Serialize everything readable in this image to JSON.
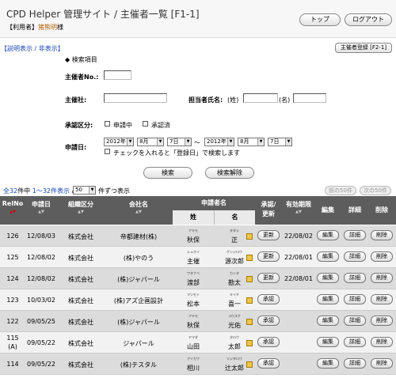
{
  "header": {
    "title": "CPD Helper 管理サイト / 主催者一覧 [F1-1]",
    "user_prefix": "【利用者】",
    "user_name": "猪熊明",
    "user_suffix": "様",
    "top_button": "トップ",
    "logout_button": "ログアウト"
  },
  "toolbar": {
    "toggle_link": "【説明表示 / 非表示】",
    "register_button": "主催者登録 [F2-1]"
  },
  "search": {
    "section_title": "◆ 検索項目",
    "organizer_no_label": "主催者No.:",
    "organizer_no_value": "",
    "organizer_label": "主催社:",
    "organizer_value": "",
    "person_label": "担当者氏名:",
    "last_name_tag": "(姓)",
    "first_name_tag": "(名)",
    "last_name_value": "",
    "first_name_value": "",
    "approval_label": "承認区分:",
    "approval_options": [
      "申請中",
      "承認済"
    ],
    "date_label": "申請日:",
    "date_from": {
      "year": "2012年",
      "month": "8月",
      "day": "7日"
    },
    "date_sep": "～",
    "date_to": {
      "year": "2012年",
      "month": "8月",
      "day": "7日"
    },
    "date_check_text": "チェックを入れると「登録日」で検索します",
    "search_button": "検索",
    "clear_button": "検索解除"
  },
  "listinfo": {
    "total_prefix": "全",
    "total_count": "32",
    "total_mid": "件中",
    "range": "1～32件表示",
    "separator": "/",
    "per_page": "50",
    "per_page_suffix": "件ずつ表示",
    "prev_button": "前の50件",
    "next_button": "次の50件"
  },
  "table": {
    "headers": {
      "relno": "RelNo",
      "date": "申請日",
      "category": "組織区分",
      "company": "会社名",
      "applicant": "申請者名",
      "approve": "承認/",
      "approve2": "更新",
      "expiry": "有効期限",
      "edit": "編集",
      "detail": "詳細",
      "delete": "削除",
      "last": "姓",
      "first": "名"
    },
    "sort_mark": "▲▼",
    "rows": [
      {
        "relno": "126",
        "relno2": "",
        "date": "12/08/03",
        "category": "株式会社",
        "company": "帝都建材(株)",
        "last_kana": "アキモ",
        "last": "秋保",
        "first_kana": "タダシ",
        "first": "正",
        "action": "更新",
        "expiry": "22/08/02",
        "edit": "編集",
        "detail": "詳細",
        "delete": "削除"
      },
      {
        "relno": "125",
        "relno2": "",
        "date": "12/08/02",
        "category": "株式会社",
        "company": "(株)やのう",
        "last_kana": "シュホイ",
        "last": "主催",
        "first_kana": "ゲンジロウ",
        "first": "源次郎",
        "action": "更新",
        "expiry": "22/08/01",
        "edit": "編集",
        "detail": "詳細",
        "delete": "削除"
      },
      {
        "relno": "124",
        "relno2": "",
        "date": "12/08/02",
        "category": "株式会社",
        "company": "(株)ジャパール",
        "last_kana": "ワタナベ",
        "last": "渡部",
        "first_kana": "カンタ",
        "first": "勘太",
        "action": "更新",
        "expiry": "22/08/01",
        "edit": "編集",
        "detail": "詳細",
        "delete": "削除"
      },
      {
        "relno": "123",
        "relno2": "",
        "date": "10/03/02",
        "category": "株式会社",
        "company": "(株)アズ企画設計",
        "last_kana": "マツモト",
        "last": "松本",
        "first_kana": "キイチ",
        "first": "喜一",
        "action": "承認",
        "expiry": "",
        "edit": "編集",
        "detail": "詳細",
        "delete": "削除"
      },
      {
        "relno": "122",
        "relno2": "",
        "date": "09/05/25",
        "category": "株式会社",
        "company": "(株)ジャパール",
        "last_kana": "アキモ",
        "last": "秋保",
        "first_kana": "コウスケ",
        "first": "光佑",
        "action": "承認",
        "expiry": "",
        "edit": "編集",
        "detail": "詳細",
        "delete": "削除"
      },
      {
        "relno": "115",
        "relno2": "(A)",
        "date": "09/05/22",
        "category": "株式会社",
        "company": "ジャパール",
        "last_kana": "ヤマダ",
        "last": "山田",
        "first_kana": "タロウ",
        "first": "太郎",
        "action": "承認",
        "expiry": "",
        "edit": "編集",
        "detail": "詳細",
        "delete": "削除"
      },
      {
        "relno": "114",
        "relno2": "",
        "date": "09/05/22",
        "category": "株式会社",
        "company": "(株)テスタル",
        "last_kana": "アイカワ",
        "last": "相川",
        "first_kana": "ツジタロウ",
        "first": "辻太郎",
        "action": "承認",
        "expiry": "",
        "edit": "編集",
        "detail": "詳細",
        "delete": "削除"
      }
    ]
  },
  "colors": {
    "link": "#1a46b5",
    "header_bg": "#5d5d5d",
    "user_name": "#b5650b",
    "sort_red": "#d00000"
  }
}
